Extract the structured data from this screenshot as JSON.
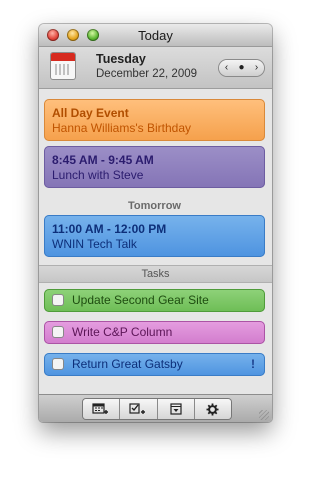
{
  "window": {
    "title": "Today"
  },
  "header": {
    "day": "Tuesday",
    "date": "December 22, 2009",
    "nav": {
      "prev": "‹",
      "today": "●",
      "next": "›"
    }
  },
  "events": [
    {
      "title": "All Day Event",
      "subtitle": "Hanna Williams's Birthday",
      "color": "#f5a04b"
    },
    {
      "title": "8:45 AM - 9:45 AM",
      "subtitle": "Lunch with Steve",
      "color": "#8474b6"
    }
  ],
  "sections": {
    "tomorrow": "Tomorrow",
    "tasks": "Tasks"
  },
  "tomorrow_events": [
    {
      "title": "11:00 AM - 12:00 PM",
      "subtitle": "WNIN Tech Talk",
      "color": "#4d93e0"
    }
  ],
  "tasks": [
    {
      "label": "Update Second Gear Site",
      "color": "#6dbd55",
      "flag": ""
    },
    {
      "label": "Write C&P Column",
      "color": "#d27ccd",
      "flag": ""
    },
    {
      "label": "Return Great Gatsby",
      "color": "#4d93e0",
      "flag": "!"
    }
  ],
  "toolbar": {
    "buttons": [
      {
        "icon": "new-event-icon"
      },
      {
        "icon": "new-task-icon"
      },
      {
        "icon": "dropdown-menu-icon"
      },
      {
        "icon": "gear-icon"
      }
    ]
  }
}
